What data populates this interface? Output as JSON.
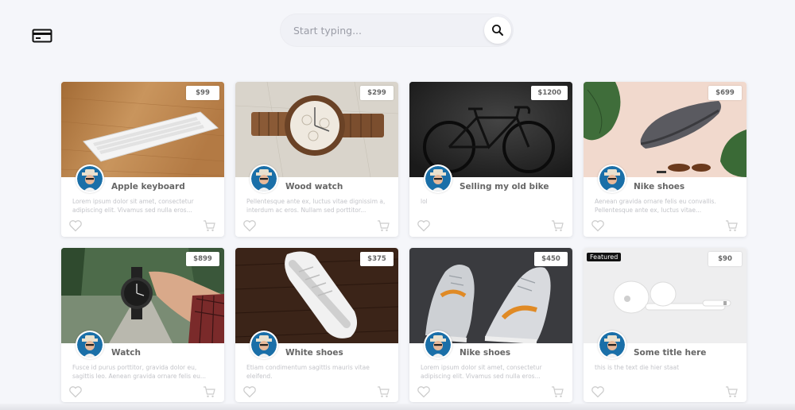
{
  "search": {
    "placeholder": "Start typing..."
  },
  "icons": {
    "logo": "credit-card-icon",
    "search": "search-icon",
    "like": "heart-icon",
    "cart": "cart-icon"
  },
  "colors": {
    "background": "#f5f6fa",
    "card": "#ffffff",
    "title": "#666666",
    "description": "#c3c4c9",
    "avatar_ring": "#1a6fa8"
  },
  "products": [
    {
      "title": "Apple keyboard",
      "price": "$99",
      "description": "Lorem ipsum dolor sit amet, consectetur adipiscing elit. Vivamus sed nulla eros..."
    },
    {
      "title": "Wood watch",
      "price": "$299",
      "description": "Pellentesque ante ex, luctus vitae dignissim a, interdum ac eros. Nullam sed porttitor..."
    },
    {
      "title": "Selling my old bike",
      "price": "$1200",
      "description": "lol"
    },
    {
      "title": "Nike shoes",
      "price": "$699",
      "description": "Aenean gravida ornare felis eu convallis. Pellentesque ante ex, luctus vitae..."
    },
    {
      "title": "Watch",
      "price": "$899",
      "description": "Fusce id purus porttitor, gravida dolor eu, sagittis leo. Aenean gravida ornare felis eu..."
    },
    {
      "title": "White shoes",
      "price": "$375",
      "description": "Etiam condimentum sagittis mauris vitae eleifend."
    },
    {
      "title": "Nike shoes",
      "price": "$450",
      "description": "Lorem ipsum dolor sit amet, consectetur adipiscing elit. Vivamus sed nulla eros..."
    },
    {
      "title": "Some title here",
      "price": "$90",
      "badge": "Featured",
      "description": "this is the text die hier staat"
    }
  ]
}
